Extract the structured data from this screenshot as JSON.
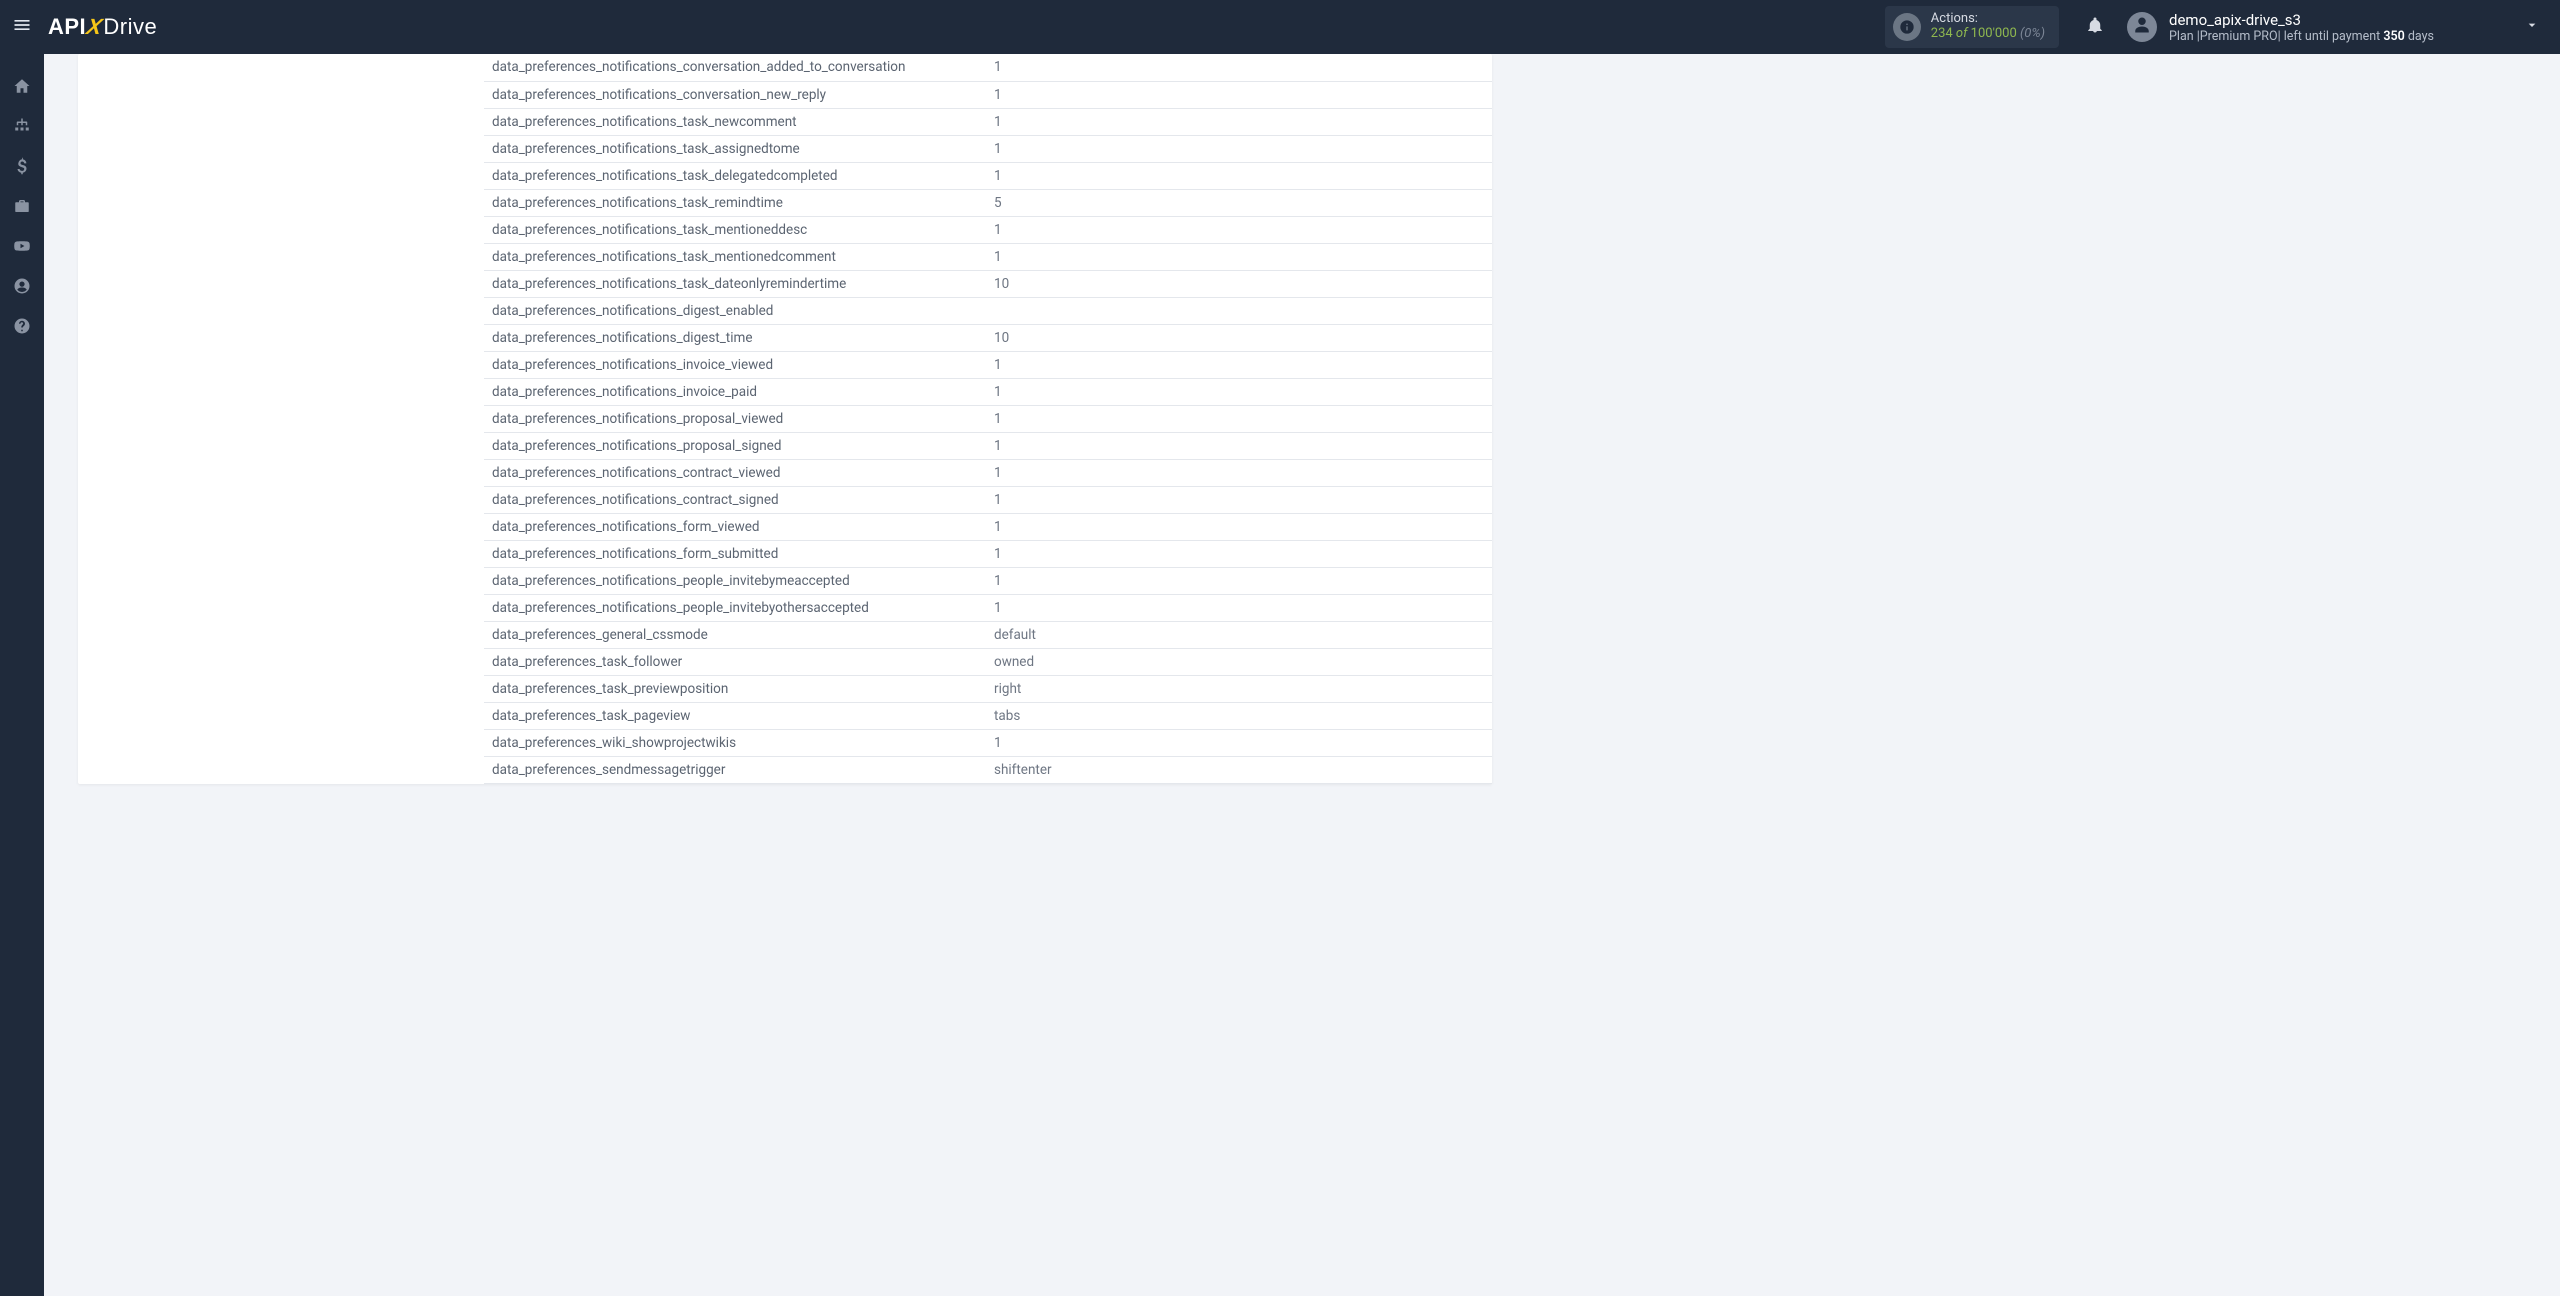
{
  "header": {
    "logo_api": "API",
    "logo_x": "X",
    "logo_drive": "Drive",
    "actions_label": "Actions:",
    "actions_used": "234",
    "actions_of": " of ",
    "actions_limit": "100'000",
    "actions_pct": " (0%)",
    "user_name": "demo_apix-drive_s3",
    "plan_prefix": "Plan |",
    "plan_name": "Premium PRO",
    "plan_mid": "| left until payment ",
    "plan_days": "350",
    "plan_suffix": " days"
  },
  "rows": [
    {
      "k": "data_preferences_notifications_conversation_added_to_conversation",
      "v": "1"
    },
    {
      "k": "data_preferences_notifications_conversation_new_reply",
      "v": "1"
    },
    {
      "k": "data_preferences_notifications_task_newcomment",
      "v": "1"
    },
    {
      "k": "data_preferences_notifications_task_assignedtome",
      "v": "1"
    },
    {
      "k": "data_preferences_notifications_task_delegatedcompleted",
      "v": "1"
    },
    {
      "k": "data_preferences_notifications_task_remindtime",
      "v": "5"
    },
    {
      "k": "data_preferences_notifications_task_mentioneddesc",
      "v": "1"
    },
    {
      "k": "data_preferences_notifications_task_mentionedcomment",
      "v": "1"
    },
    {
      "k": "data_preferences_notifications_task_dateonlyremindertime",
      "v": "10"
    },
    {
      "k": "data_preferences_notifications_digest_enabled",
      "v": ""
    },
    {
      "k": "data_preferences_notifications_digest_time",
      "v": "10"
    },
    {
      "k": "data_preferences_notifications_invoice_viewed",
      "v": "1"
    },
    {
      "k": "data_preferences_notifications_invoice_paid",
      "v": "1"
    },
    {
      "k": "data_preferences_notifications_proposal_viewed",
      "v": "1"
    },
    {
      "k": "data_preferences_notifications_proposal_signed",
      "v": "1"
    },
    {
      "k": "data_preferences_notifications_contract_viewed",
      "v": "1"
    },
    {
      "k": "data_preferences_notifications_contract_signed",
      "v": "1"
    },
    {
      "k": "data_preferences_notifications_form_viewed",
      "v": "1"
    },
    {
      "k": "data_preferences_notifications_form_submitted",
      "v": "1"
    },
    {
      "k": "data_preferences_notifications_people_invitebymeaccepted",
      "v": "1"
    },
    {
      "k": "data_preferences_notifications_people_invitebyothersaccepted",
      "v": "1"
    },
    {
      "k": "data_preferences_general_cssmode",
      "v": "default"
    },
    {
      "k": "data_preferences_task_follower",
      "v": "owned"
    },
    {
      "k": "data_preferences_task_previewposition",
      "v": "right"
    },
    {
      "k": "data_preferences_task_pageview",
      "v": "tabs"
    },
    {
      "k": "data_preferences_wiki_showprojectwikis",
      "v": "1"
    },
    {
      "k": "data_preferences_sendmessagetrigger",
      "v": "shiftenter"
    }
  ]
}
